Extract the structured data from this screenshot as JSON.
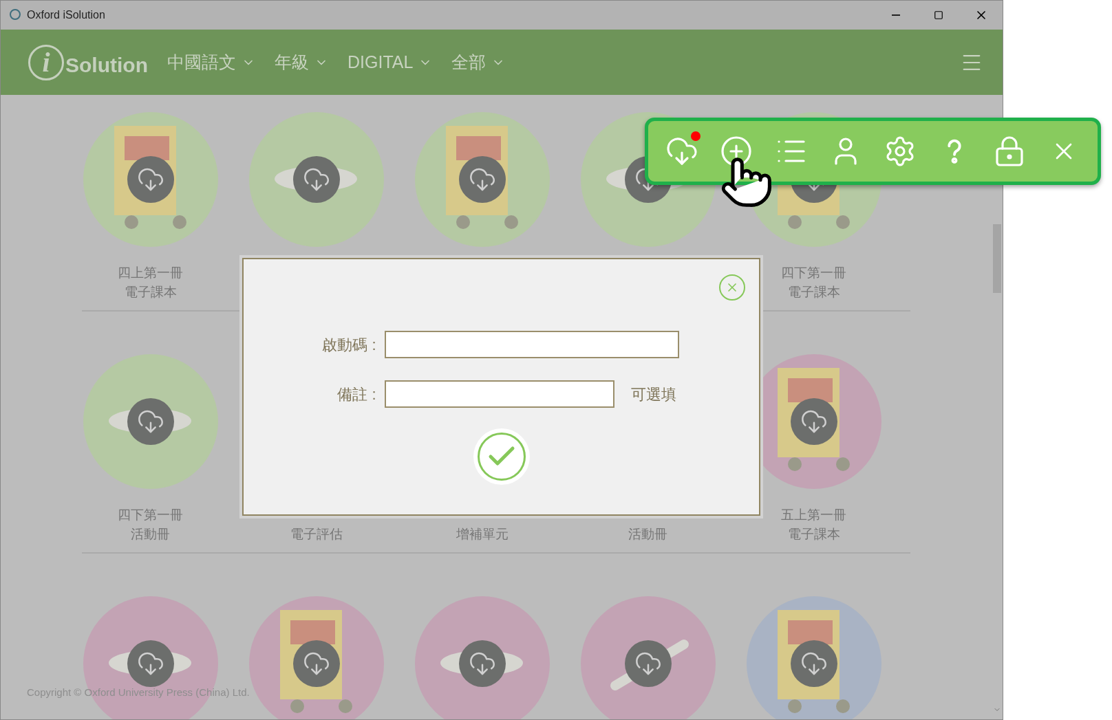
{
  "window": {
    "title": "Oxford iSolution"
  },
  "header": {
    "logo": {
      "mark": "i",
      "text": "Solution"
    },
    "menus": [
      {
        "label": "中國語文"
      },
      {
        "label": "年級"
      },
      {
        "label": "DIGITAL"
      },
      {
        "label": "全部"
      }
    ]
  },
  "grid": {
    "rows": [
      [
        {
          "kind": "book",
          "color": "#b5c9a3",
          "lines": [
            "四上第一冊",
            "電子課本"
          ]
        },
        {
          "kind": "mascot",
          "color": "#b5c9a3"
        },
        {
          "kind": "book",
          "color": "#b5c9a3"
        },
        {
          "kind": "mascot",
          "color": "#b5c9a3"
        },
        {
          "kind": "book",
          "color": "#b5c9a3",
          "lines": [
            "四下第一冊",
            "電子課本"
          ]
        }
      ],
      [
        {
          "kind": "mascot",
          "color": "#b5c9a3",
          "lines": [
            "四下第一冊",
            "活動冊"
          ]
        },
        {
          "kind": "none",
          "lines": [
            "電子評估"
          ]
        },
        {
          "kind": "none",
          "lines": [
            "增補單元"
          ]
        },
        {
          "kind": "none",
          "lines": [
            "活動冊"
          ]
        },
        {
          "kind": "book",
          "color": "#c3a3b4",
          "lines": [
            "五上第一冊",
            "電子課本"
          ]
        }
      ],
      [
        {
          "kind": "mascot",
          "color": "#c3a3b4"
        },
        {
          "kind": "book",
          "color": "#c3a3b4"
        },
        {
          "kind": "mascot",
          "color": "#c3a3b4"
        },
        {
          "kind": "stick",
          "color": "#c3a3b4"
        },
        {
          "kind": "book",
          "color": "#a9b3c4"
        }
      ]
    ]
  },
  "footer": {
    "copyright": "Copyright © Oxford University Press (China) Ltd."
  },
  "dialog": {
    "fields": [
      {
        "label": "啟動碼 :"
      },
      {
        "label": "備註 :",
        "hint": "可選填"
      }
    ]
  },
  "toolbar": {
    "buttons": [
      {
        "kind": "download",
        "badge": true
      },
      {
        "kind": "add",
        "badge": false
      },
      {
        "kind": "list",
        "badge": false
      },
      {
        "kind": "user",
        "badge": false
      },
      {
        "kind": "settings",
        "badge": false
      },
      {
        "kind": "help",
        "badge": false
      },
      {
        "kind": "lock",
        "badge": false
      },
      {
        "kind": "close",
        "badge": false
      }
    ]
  }
}
